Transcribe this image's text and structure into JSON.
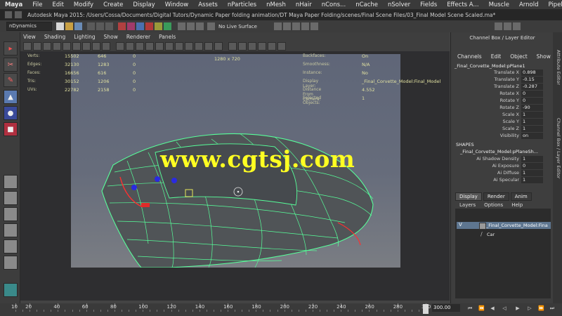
{
  "app": {
    "menu": [
      "Maya",
      "File",
      "Edit",
      "Modify",
      "Create",
      "Display",
      "Window",
      "Assets",
      "nParticles",
      "nMesh",
      "nHair",
      "nCons...",
      "nCache",
      "nSolver",
      "Fields",
      "Effects A...",
      "Muscle",
      "Arnold",
      "Pipeline"
    ],
    "title": "Autodesk Maya 2015: /Users/Cossa/Documents/Digital Tutors/Dynamic Paper folding animation/DT Maya Paper Folding/scenes/Final Scene Files/03_Final Model Scene Scaled.ma*"
  },
  "status_line": {
    "menu_set": "nDynamics",
    "live_surface": "No Live Surface"
  },
  "viewport": {
    "menu": [
      "View",
      "Shading",
      "Lighting",
      "Show",
      "Renderer",
      "Panels"
    ],
    "resolution_gate": "1280 x 720",
    "hud_left": [
      {
        "label": "Verts:",
        "v1": "15502",
        "v2": "646",
        "v3": "0"
      },
      {
        "label": "Edges:",
        "v1": "32130",
        "v2": "1283",
        "v3": "0"
      },
      {
        "label": "Faces:",
        "v1": "16656",
        "v2": "616",
        "v3": "0"
      },
      {
        "label": "Tris:",
        "v1": "30152",
        "v2": "1206",
        "v3": "0"
      },
      {
        "label": "UVs:",
        "v1": "22782",
        "v2": "2158",
        "v3": "0"
      }
    ],
    "hud_right": [
      {
        "label": "Backfaces:",
        "value": "On"
      },
      {
        "label": "Smoothness:",
        "value": "N/A"
      },
      {
        "label": "Instance:",
        "value": "No"
      },
      {
        "label": "Display Layer:",
        "value": "_Final_Corvette_Model:Final_Model"
      },
      {
        "label": "Distance From Camera:",
        "value": "4.552"
      },
      {
        "label": "Selected Objects:",
        "value": "1"
      }
    ],
    "watermark": "www.cgtsj.com"
  },
  "channel_box": {
    "tabs": [
      "Channels",
      "Edit",
      "Object",
      "Show"
    ],
    "object_name": "_Final_Corvette_Model:pPlane1",
    "attributes": [
      {
        "name": "Translate X",
        "value": "0.898"
      },
      {
        "name": "Translate Y",
        "value": "-0.15"
      },
      {
        "name": "Translate Z",
        "value": "-0.287"
      },
      {
        "name": "Rotate X",
        "value": "0"
      },
      {
        "name": "Rotate Y",
        "value": "0"
      },
      {
        "name": "Rotate Z",
        "value": "-90"
      },
      {
        "name": "Scale X",
        "value": "1"
      },
      {
        "name": "Scale Y",
        "value": "1"
      },
      {
        "name": "Scale Z",
        "value": "1"
      },
      {
        "name": "Visibility",
        "value": "on"
      }
    ],
    "shapes_header": "SHAPES",
    "shape_name": "_Final_Corvette_Model:pPlaneSh...",
    "shape_attributes": [
      {
        "name": "Ai Shadow Density",
        "value": "1"
      },
      {
        "name": "Ai Exposure",
        "value": "0"
      },
      {
        "name": "Ai Diffuse",
        "value": "1"
      },
      {
        "name": "Ai Specular",
        "value": "1"
      }
    ]
  },
  "layer_editor": {
    "tabs": [
      "Display",
      "Render",
      "Anim"
    ],
    "menu": [
      "Layers",
      "Options",
      "Help"
    ],
    "layers": [
      {
        "v": "V",
        "name": "_Final_Corvette_Model:Fina"
      },
      {
        "v": "",
        "name": "Car"
      }
    ]
  },
  "vertical_tabs": [
    "Attribute Editor",
    "Channel Box / Layer Editor"
  ],
  "time_slider": {
    "ticks": [
      "10",
      "20",
      "40",
      "60",
      "80",
      "100",
      "120",
      "140",
      "160",
      "180",
      "200",
      "220",
      "240",
      "260",
      "280",
      "300"
    ],
    "current_time": "300.00"
  }
}
